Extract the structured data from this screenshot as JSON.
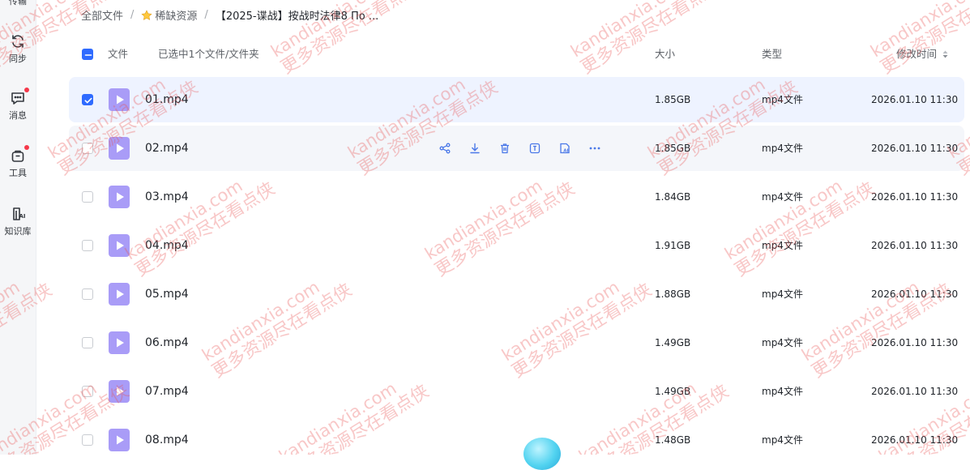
{
  "sidebar": {
    "top_partial_label": "传输",
    "items": [
      {
        "id": "sync",
        "label": "同步",
        "icon": "sync-icon",
        "badge": false
      },
      {
        "id": "messages",
        "label": "消息",
        "icon": "message-icon",
        "badge": true
      },
      {
        "id": "tools",
        "label": "工具",
        "icon": "tools-icon",
        "badge": true
      },
      {
        "id": "knowledge",
        "label": "知识库",
        "icon": "ai-knowledge-icon",
        "badge": false
      }
    ]
  },
  "breadcrumb": {
    "root": "全部文件",
    "folder": "稀缺资源",
    "current": "【2025-谍战】按战时法律8 По ..."
  },
  "header": {
    "file_label": "文件",
    "selection_text": "已选中1个文件/文件夹",
    "size_label": "大小",
    "type_label": "类型",
    "modified_label": "修改时间"
  },
  "files": [
    {
      "name": "01.mp4",
      "size": "1.85GB",
      "type": "mp4文件",
      "modified": "2026.01.10 11:30"
    },
    {
      "name": "02.mp4",
      "size": "1.85GB",
      "type": "mp4文件",
      "modified": "2026.01.10 11:30"
    },
    {
      "name": "03.mp4",
      "size": "1.84GB",
      "type": "mp4文件",
      "modified": "2026.01.10 11:30"
    },
    {
      "name": "04.mp4",
      "size": "1.91GB",
      "type": "mp4文件",
      "modified": "2026.01.10 11:30"
    },
    {
      "name": "05.mp4",
      "size": "1.88GB",
      "type": "mp4文件",
      "modified": "2026.01.10 11:30"
    },
    {
      "name": "06.mp4",
      "size": "1.49GB",
      "type": "mp4文件",
      "modified": "2026.01.10 11:30"
    },
    {
      "name": "07.mp4",
      "size": "1.49GB",
      "type": "mp4文件",
      "modified": "2026.01.10 11:30"
    },
    {
      "name": "08.mp4",
      "size": "1.48GB",
      "type": "mp4文件",
      "modified": "2026.01.10 11:30"
    }
  ],
  "selected_row": 0,
  "hover_row": 1,
  "row_actions": [
    "share-icon",
    "download-icon",
    "delete-icon",
    "text-extract-icon",
    "ai-icon",
    "more-icon"
  ],
  "watermark": {
    "line1": "kandianxia.com",
    "line2": "更多资源尽在看点侠"
  },
  "colors": {
    "accent": "#2f6bff",
    "selected_row_bg": "#eef3ff",
    "hover_row_bg": "#f4f6fa",
    "video_icon": "#a99cf7",
    "watermark": "#e85050",
    "badge": "#f5384a"
  }
}
